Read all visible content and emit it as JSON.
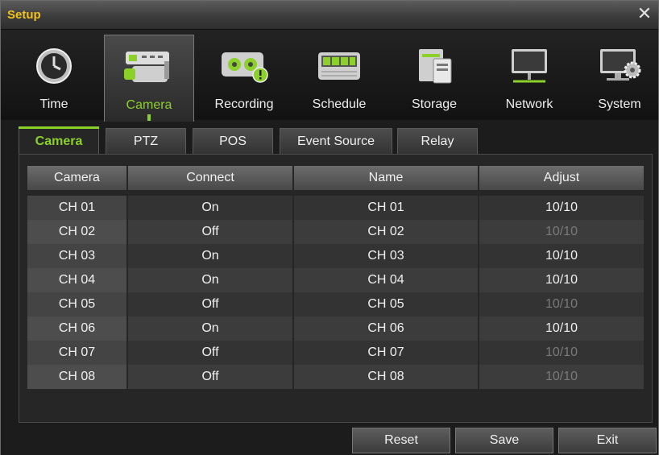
{
  "window": {
    "title": "Setup"
  },
  "iconbar": {
    "items": [
      {
        "label": "Time",
        "icon": "clock-icon"
      },
      {
        "label": "Camera",
        "icon": "camera-icon"
      },
      {
        "label": "Recording",
        "icon": "tape-recorder-icon"
      },
      {
        "label": "Schedule",
        "icon": "schedule-icon"
      },
      {
        "label": "Storage",
        "icon": "storage-icon"
      },
      {
        "label": "Network",
        "icon": "monitor-network-icon"
      },
      {
        "label": "System",
        "icon": "monitor-gear-icon"
      }
    ],
    "selected": "Camera"
  },
  "tabs": {
    "items": [
      "Camera",
      "PTZ",
      "POS",
      "Event Source",
      "Relay"
    ],
    "selected": "Camera"
  },
  "table": {
    "columns": [
      "Camera",
      "Connect",
      "Name",
      "Adjust"
    ],
    "rows": [
      {
        "camera": "CH 01",
        "connect": "On",
        "name": "CH 01",
        "adjust": "10/10",
        "active": true
      },
      {
        "camera": "CH 02",
        "connect": "Off",
        "name": "CH 02",
        "adjust": "10/10",
        "active": false
      },
      {
        "camera": "CH 03",
        "connect": "On",
        "name": "CH 03",
        "adjust": "10/10",
        "active": true
      },
      {
        "camera": "CH 04",
        "connect": "On",
        "name": "CH 04",
        "adjust": "10/10",
        "active": true
      },
      {
        "camera": "CH 05",
        "connect": "Off",
        "name": "CH 05",
        "adjust": "10/10",
        "active": false
      },
      {
        "camera": "CH 06",
        "connect": "On",
        "name": "CH 06",
        "adjust": "10/10",
        "active": true
      },
      {
        "camera": "CH 07",
        "connect": "Off",
        "name": "CH 07",
        "adjust": "10/10",
        "active": false
      },
      {
        "camera": "CH 08",
        "connect": "Off",
        "name": "CH 08",
        "adjust": "10/10",
        "active": false
      }
    ]
  },
  "buttons": {
    "reset": "Reset",
    "save": "Save",
    "exit": "Exit"
  },
  "colors": {
    "accent": "#8cd12a",
    "title": "#f2c11a",
    "dim_text": "#7a7a7a"
  }
}
